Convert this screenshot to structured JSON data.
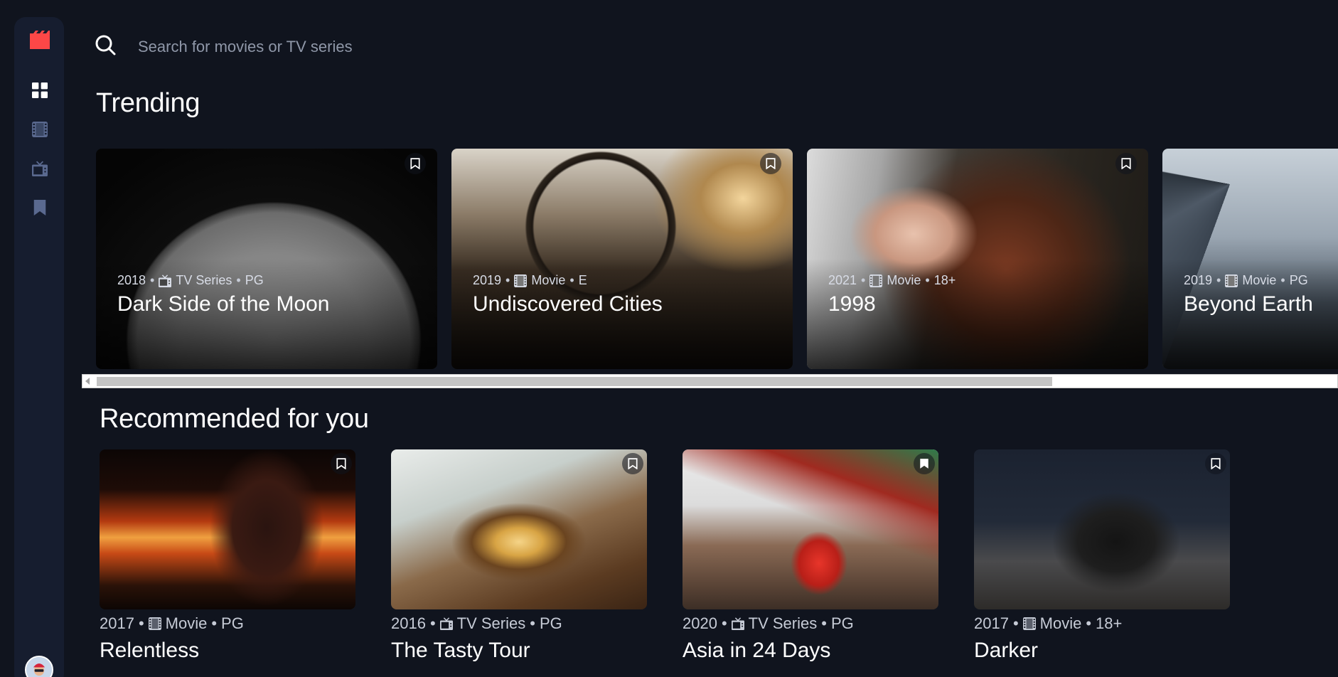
{
  "sidebar": {
    "logo_icon": "film-clapper-icon",
    "items": [
      {
        "name": "home",
        "icon": "grid-icon",
        "active": true
      },
      {
        "name": "movies",
        "icon": "film-strip-icon",
        "active": false
      },
      {
        "name": "tv-series",
        "icon": "tv-icon",
        "active": false
      },
      {
        "name": "bookmarks",
        "icon": "bookmark-icon",
        "active": false
      }
    ],
    "avatar": "user-avatar"
  },
  "search": {
    "placeholder": "Search for movies or TV series"
  },
  "trending": {
    "title": "Trending",
    "items": [
      {
        "year": "2018",
        "category": "TV Series",
        "category_icon": "tv-icon",
        "rating": "PG",
        "title": "Dark Side of the Moon"
      },
      {
        "year": "2019",
        "category": "Movie",
        "category_icon": "film-strip-icon",
        "rating": "E",
        "title": "Undiscovered Cities"
      },
      {
        "year": "2021",
        "category": "Movie",
        "category_icon": "film-strip-icon",
        "rating": "18+",
        "title": "1998"
      },
      {
        "year": "2019",
        "category": "Movie",
        "category_icon": "film-strip-icon",
        "rating": "PG",
        "title": "Beyond Earth"
      }
    ]
  },
  "recommended": {
    "title": "Recommended for you",
    "items": [
      {
        "year": "2017",
        "category": "Movie",
        "category_icon": "film-strip-icon",
        "rating": "PG",
        "title": "Relentless"
      },
      {
        "year": "2016",
        "category": "TV Series",
        "category_icon": "tv-icon",
        "rating": "PG",
        "title": "The Tasty Tour"
      },
      {
        "year": "2020",
        "category": "TV Series",
        "category_icon": "tv-icon",
        "rating": "PG",
        "title": "Asia in 24 Days"
      },
      {
        "year": "2017",
        "category": "Movie",
        "category_icon": "film-strip-icon",
        "rating": "18+",
        "title": "Darker"
      }
    ]
  },
  "separator": "•",
  "colors": {
    "background": "#10141e",
    "sidebar": "#161d2f",
    "accent_red": "#fc4747",
    "nav_inactive": "#5a698f",
    "text_muted": "#c6cbd6"
  }
}
